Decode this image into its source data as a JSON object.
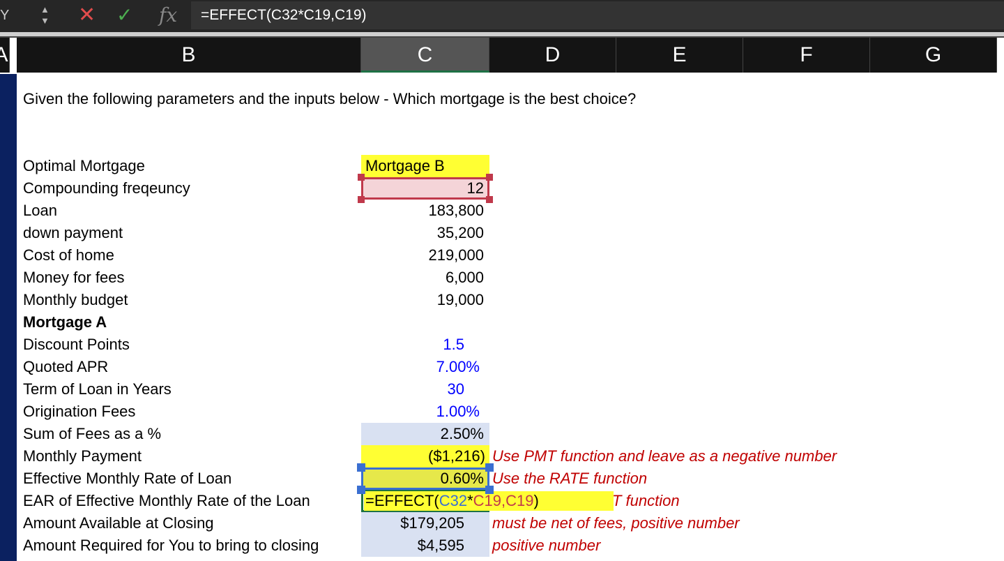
{
  "formula_bar": {
    "name_box": "Y",
    "formula": "=EFFECT(C32*C19,C19)",
    "cancel_icon": "x-icon",
    "enter_icon": "check-icon",
    "fx_label": "fx"
  },
  "columns": [
    "A",
    "B",
    "C",
    "D",
    "E",
    "F",
    "G"
  ],
  "title": "Given the following parameters and the inputs below - Which mortgage is the best choice?",
  "rows": [
    {
      "label": "Optimal Mortgage",
      "value": "Mortgage B"
    },
    {
      "label": "Compounding freqeuncy",
      "value": "12"
    },
    {
      "label": "Loan",
      "value": "183,800"
    },
    {
      "label": "down payment",
      "value": "35,200"
    },
    {
      "label": "Cost of home",
      "value": "219,000"
    },
    {
      "label": "Money for fees",
      "value": "6,000"
    },
    {
      "label": "Monthly budget",
      "value": "19,000"
    },
    {
      "label": "Mortgage A",
      "value": ""
    },
    {
      "label": "Discount Points",
      "value": "1.5"
    },
    {
      "label": "Quoted APR",
      "value": "7.00%"
    },
    {
      "label": "Term of Loan in Years",
      "value": "30"
    },
    {
      "label": "Origination Fees",
      "value": "1.00%"
    },
    {
      "label": "Sum of Fees as a %",
      "value": "2.50%"
    },
    {
      "label": "Monthly Payment",
      "value": "($1,216)",
      "note": "Use PMT function and leave as a negative number"
    },
    {
      "label": "Effective Monthly Rate of Loan",
      "value": "0.60%",
      "note": "Use the RATE function"
    },
    {
      "label": "EAR of Effective Monthly Rate of the Loan",
      "value": "",
      "note": "T function"
    },
    {
      "label": "Amount Available at Closing",
      "value": "$179,205",
      "note": "must be net of fees, positive number"
    },
    {
      "label": "Amount Required for You to bring to closing",
      "value": "$4,595",
      "note": "positive number"
    }
  ],
  "edit": {
    "p1": "=EFFECT(",
    "p2": "C32",
    "p3": "*",
    "p4": "C19,C19",
    "p5": ")"
  },
  "colors": {
    "ref_blue": "#3a6fd1",
    "ref_red": "#c0394b",
    "note": "#c00000",
    "input_blue": "#0000ff",
    "highlight": "#ffff33",
    "calc": "#d9e1f2"
  }
}
